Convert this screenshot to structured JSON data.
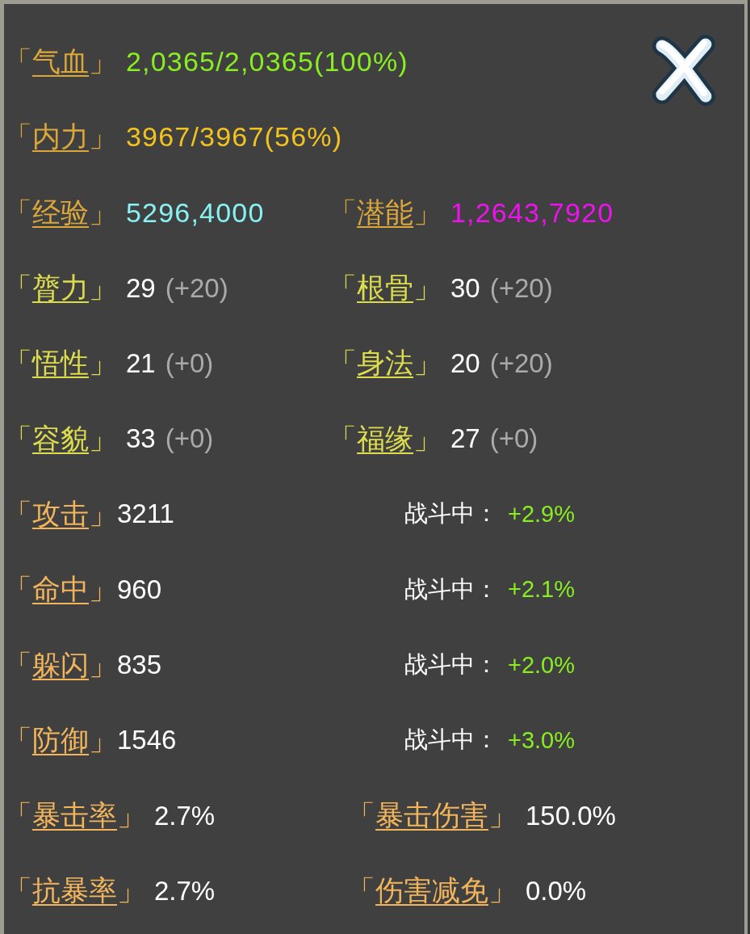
{
  "vitals": [
    {
      "open": "「",
      "label": "气血",
      "close": "」",
      "value": "2,0365/2,0365(100%)",
      "color": "#88ee22"
    },
    {
      "open": "「",
      "label": "内力",
      "close": "」",
      "value": "3967/3967(56%)",
      "color": "#f2c21e"
    }
  ],
  "progress": [
    {
      "open": "「",
      "label": "经验",
      "close": "」",
      "value": "5296,4000",
      "color": "#88f2f2"
    },
    {
      "open": "「",
      "label": "潜能",
      "close": "」",
      "value": "1,2643,7920",
      "color": "#ee12ee"
    }
  ],
  "attributes": [
    {
      "open": "「",
      "label": "膂力",
      "close": "」",
      "value": "29",
      "bonus": "(+20)"
    },
    {
      "open": "「",
      "label": "根骨",
      "close": "」",
      "value": "30",
      "bonus": "(+20)"
    },
    {
      "open": "「",
      "label": "悟性",
      "close": "」",
      "value": "21",
      "bonus": "(+0)"
    },
    {
      "open": "「",
      "label": "身法",
      "close": "」",
      "value": "20",
      "bonus": "(+20)"
    },
    {
      "open": "「",
      "label": "容貌",
      "close": "」",
      "value": "33",
      "bonus": "(+0)"
    },
    {
      "open": "「",
      "label": "福缘",
      "close": "」",
      "value": "27",
      "bonus": "(+0)"
    }
  ],
  "combat": [
    {
      "open": "「",
      "label": "攻击",
      "close": "」",
      "value": "3211",
      "battle_label": "战斗中：",
      "battle_bonus": "+2.9%"
    },
    {
      "open": "「",
      "label": "命中",
      "close": "」",
      "value": "960",
      "battle_label": "战斗中：",
      "battle_bonus": "+2.1%"
    },
    {
      "open": "「",
      "label": "躲闪",
      "close": "」",
      "value": "835",
      "battle_label": "战斗中：",
      "battle_bonus": "+2.0%"
    },
    {
      "open": "「",
      "label": "防御",
      "close": "」",
      "value": "1546",
      "battle_label": "战斗中：",
      "battle_bonus": "+3.0%"
    }
  ],
  "rates": [
    {
      "open": "「",
      "label": "暴击率",
      "close": "」",
      "value": "2.7%"
    },
    {
      "open": "「",
      "label": "暴击伤害",
      "close": "」",
      "value": "150.0%"
    },
    {
      "open": "「",
      "label": "抗暴率",
      "close": "」",
      "value": "2.7%"
    },
    {
      "open": "「",
      "label": "伤害减免",
      "close": "」",
      "value": "0.0%"
    }
  ]
}
